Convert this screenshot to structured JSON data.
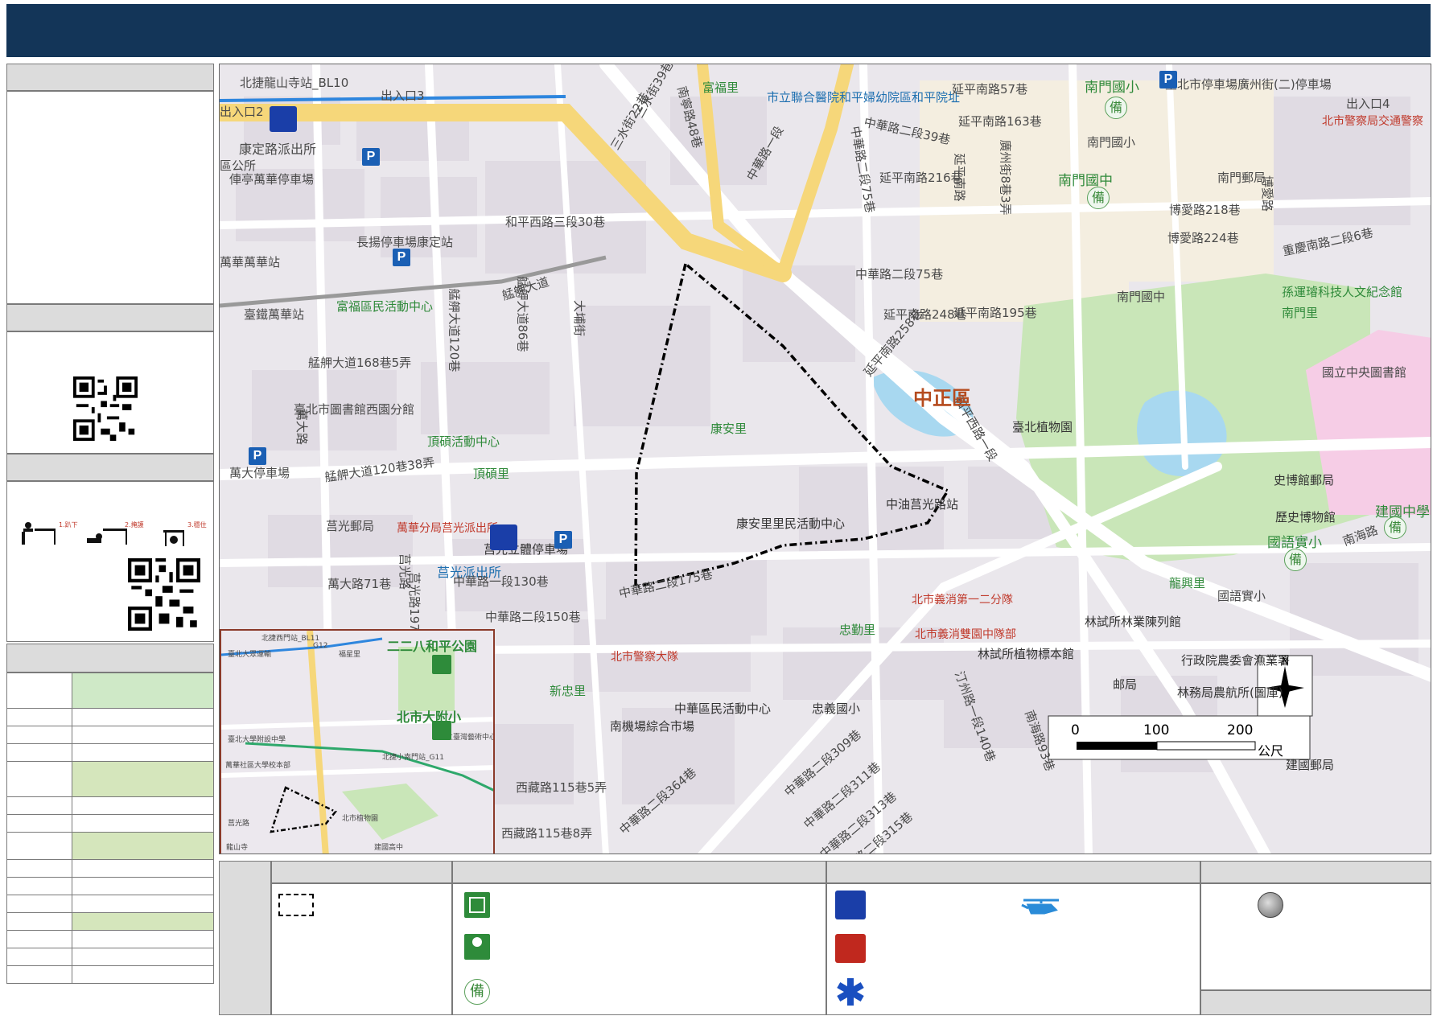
{
  "map": {
    "district": "中正區",
    "roads": [
      "北捷龍山寺站_BL10",
      "出入口3",
      "出入口2",
      "康定路派出所",
      "區公所",
      "俥亭萬華停車場",
      "三水街22巷",
      "三水街39巷",
      "南寧路48巷",
      "富福里",
      "市立聯合醫院和平婦幼院區和平院址",
      "中華路二段39巷",
      "延平南路57巷",
      "延平南路163巷",
      "中華路一段",
      "中華路二段75巷",
      "延平南路216巷",
      "延平南路",
      "廣州街8巷3弄",
      "南門國小",
      "臺北市停車場廣州街(二)停車場",
      "南門國小",
      "南門國中",
      "南門郵局",
      "博愛路218巷",
      "博愛路",
      "博愛路224巷",
      "重慶南路二段6巷",
      "孫運璿科技人文紀念館",
      "南門里",
      "南門國中",
      "中華路二段75巷",
      "和平西路三段30巷",
      "長揚停車場康定站",
      "萬華萬華站",
      "臺鐵萬華站",
      "富福區民活動中心",
      "艋舺大道",
      "艋舺大道120巷",
      "艋舺大道86巷",
      "大埔街",
      "延平南路248巷",
      "延平南路258巷",
      "延平南路195巷",
      "國立中央圖書館",
      "艋舺大道168巷5弄",
      "臺北市圖書館西園分館",
      "頂碩活動中心",
      "頂碩里",
      "萬大路",
      "萬大停車場",
      "艋舺大道120巷38弄",
      "莒光郵局",
      "康安里",
      "和平西路一段",
      "臺北植物園",
      "中油莒光路站",
      "史博館郵局",
      "歷史博物館",
      "建國中學",
      "國語實小",
      "南海路",
      "萬華分局莒光派出所",
      "莒光派出所",
      "莒光立體停車場",
      "康安里里民活動中心",
      "莒光路",
      "中華路一段130巷",
      "萬大路71巷",
      "莒光路197巷",
      "中華路二段175巷",
      "中華路二段150巷",
      "北市義消第一二分隊",
      "北市義消雙園中隊部",
      "林試所林業陳列館",
      "林試所植物標本館",
      "行政院農委會漁業署",
      "林務局農航所(圖庫)",
      "忠勤里",
      "龍興里",
      "北市警察大隊",
      "新忠里",
      "中華區民活動中心",
      "忠義國小",
      "南機場綜合市場",
      "西藏路115巷5弄",
      "西藏路115巷8弄",
      "中華路二段364巷",
      "中華路二段309巷",
      "中華路二段311巷",
      "中華路二段313巷",
      "中華路二段315巷",
      "汀州路一段140巷",
      "南海路93巷",
      "邮局",
      "建國郵局",
      "出入口4",
      "北市警察局交通警察",
      "國語實小"
    ],
    "scale": {
      "ticks": [
        "0",
        "100",
        "200"
      ],
      "unit": "公尺"
    },
    "north": "N"
  },
  "inset": {
    "labels": [
      "二二八和平公園",
      "北市大附小",
      "北捷西門站_BL11",
      "臺北大眾運輸",
      "福星里",
      "北捷小南門站_G11",
      "臺北大學附設中學",
      "國立臺灣藝術中心",
      "萬華社區大學校本部",
      "北市植物園",
      "莒光路",
      "建國高中",
      "G12",
      "龍山寺"
    ]
  },
  "qr": [
    "qr-code-1",
    "qr-code-2"
  ],
  "icons": {
    "police": "police-icon",
    "fire": "fire-station-icon",
    "medical": "medical-icon",
    "shelter": "shelter-icon",
    "park": "park-evacuation-icon",
    "backup": "備",
    "helicopter": "helicopter-icon",
    "circle": "circle-marker-icon"
  },
  "colors": {
    "header": "#133558",
    "panelHead": "#dcdcdc",
    "greenRow": "#cfe9c7",
    "greenRow2": "#d5e6bc",
    "mapBg": "#eae7ec",
    "park": "#c9e6b8",
    "school": "#f7e7c2"
  }
}
